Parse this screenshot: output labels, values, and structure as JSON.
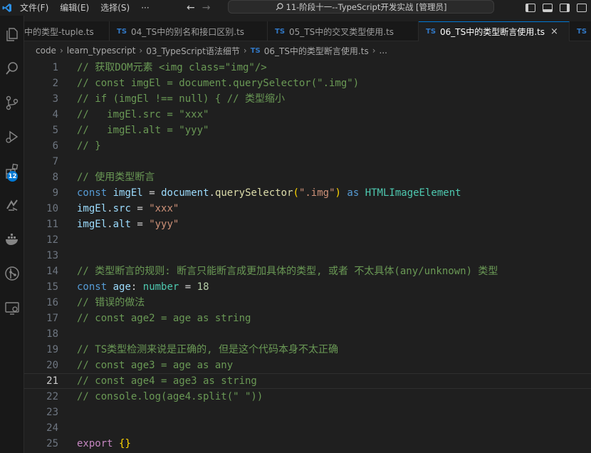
{
  "menu": [
    "文件(F)",
    "编辑(E)",
    "选择(S)",
    "···"
  ],
  "window_title": "11-阶段十一--TypeScript开发实战 [管理员]",
  "tabs": [
    {
      "label": "中的类型-tuple.ts",
      "active": false
    },
    {
      "label": "04_TS中的别名和接口区别.ts",
      "active": false
    },
    {
      "label": "05_TS中的交叉类型使用.ts",
      "active": false
    },
    {
      "label": "06_TS中的类型断言使用.ts",
      "active": true
    },
    {
      "label": "",
      "active": false
    }
  ],
  "tab_lang_badge": "TS",
  "close_glyph": "×",
  "breadcrumb": {
    "parts": [
      "code",
      "learn_typescript",
      "03_TypeScript语法细节",
      "06_TS中的类型断言使用.ts",
      "..."
    ],
    "separator": "›"
  },
  "activity_badge": "12",
  "editor": {
    "current_line": 21,
    "lines": [
      {
        "n": "1",
        "text": "// 获取DOM元素 <img class=\"img\"/>"
      },
      {
        "n": "2",
        "text": "// const imgEl = document.querySelector(\".img\")"
      },
      {
        "n": "3",
        "text": "// if (imgEl !== null) { // 类型缩小"
      },
      {
        "n": "4",
        "text": "//   imgEl.src = \"xxx\""
      },
      {
        "n": "5",
        "text": "//   imgEl.alt = \"yyy\""
      },
      {
        "n": "6",
        "text": "// }"
      },
      {
        "n": "7",
        "text": ""
      },
      {
        "n": "8",
        "text": "// 使用类型断言"
      },
      {
        "n": "9",
        "text": "const imgEl = document.querySelector(\".img\") as HTMLImageElement"
      },
      {
        "n": "10",
        "text": "imgEl.src = \"xxx\""
      },
      {
        "n": "11",
        "text": "imgEl.alt = \"yyy\""
      },
      {
        "n": "12",
        "text": ""
      },
      {
        "n": "13",
        "text": ""
      },
      {
        "n": "14",
        "text": "// 类型断言的规则: 断言只能断言成更加具体的类型, 或者 不太具体(any/unknown) 类型"
      },
      {
        "n": "15",
        "text": "const age: number = 18"
      },
      {
        "n": "16",
        "text": "// 错误的做法"
      },
      {
        "n": "17",
        "text": "// const age2 = age as string"
      },
      {
        "n": "18",
        "text": ""
      },
      {
        "n": "19",
        "text": "// TS类型检测来说是正确的, 但是这个代码本身不太正确"
      },
      {
        "n": "20",
        "text": "// const age3 = age as any"
      },
      {
        "n": "21",
        "text": "// const age4 = age3 as string"
      },
      {
        "n": "22",
        "text": "// console.log(age4.split(\" \"))"
      },
      {
        "n": "23",
        "text": ""
      },
      {
        "n": "24",
        "text": ""
      },
      {
        "n": "25",
        "text": "export {}"
      }
    ]
  },
  "colors": {
    "comment": "#6a9955",
    "keyword": "#569cd6",
    "variable": "#9cdcfe",
    "function": "#dcdcaa",
    "string": "#ce9178",
    "type": "#4ec9b0",
    "number": "#b5cea8",
    "accent": "#0078d4"
  }
}
